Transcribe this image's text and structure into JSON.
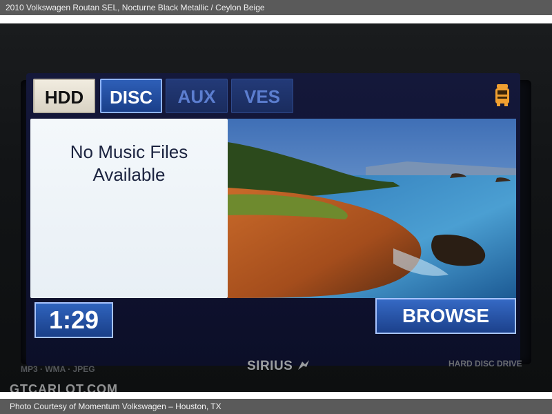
{
  "caption": {
    "top": "2010 Volkswagen Routan SEL,  Nocturne Black Metallic / Ceylon Beige",
    "bottom": "Photo Courtesy of Momentum Volkswagen – Houston, TX"
  },
  "source_tabs": [
    {
      "label": "HDD",
      "state": "normal"
    },
    {
      "label": "DISC",
      "state": "selected"
    },
    {
      "label": "AUX",
      "state": "disabled"
    },
    {
      "label": "VES",
      "state": "disabled"
    }
  ],
  "message": {
    "line1": "No Music Files",
    "line2": "Available"
  },
  "playback": {
    "time": "1:29",
    "browse_label": "BROWSE"
  },
  "panel": {
    "formats_label": "MP3 · WMA · JPEG",
    "brand_logo": "SIRIUS",
    "drive_label": "HARD DISC DRIVE"
  },
  "watermark": "GTCARLOT.COM",
  "icons": {
    "vehicle": "minivan-icon",
    "sirius": "sirius-dog-icon"
  },
  "colors": {
    "accent_blue": "#2e5fb8",
    "highlight_border": "#a8c4ff",
    "vehicle_icon": "#f0a030"
  }
}
